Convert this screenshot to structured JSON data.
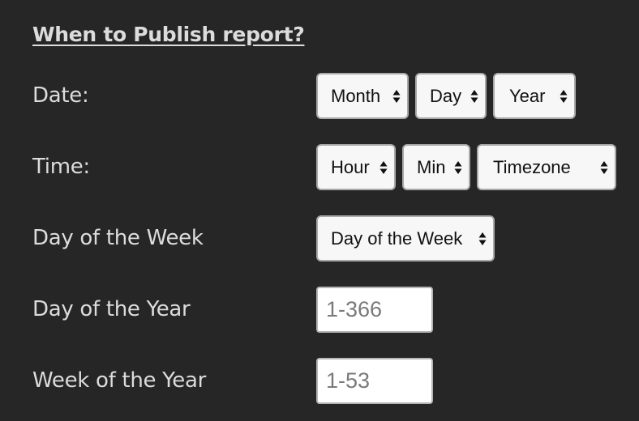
{
  "form": {
    "title": "When to Publish report?",
    "rows": {
      "date": {
        "label": "Date:",
        "month": "Month",
        "day": "Day",
        "year": "Year"
      },
      "time": {
        "label": "Time:",
        "hour": "Hour",
        "min": "Min",
        "timezone": "Timezone"
      },
      "day_of_week": {
        "label": "Day of the Week",
        "select": "Day of the Week"
      },
      "day_of_year": {
        "label": "Day of the Year",
        "placeholder": "1-366",
        "value": ""
      },
      "week_of_year": {
        "label": "Week of the Year",
        "placeholder": "1-53",
        "value": ""
      }
    }
  },
  "icons": {
    "select_arrow": "up-down-arrows-icon"
  }
}
